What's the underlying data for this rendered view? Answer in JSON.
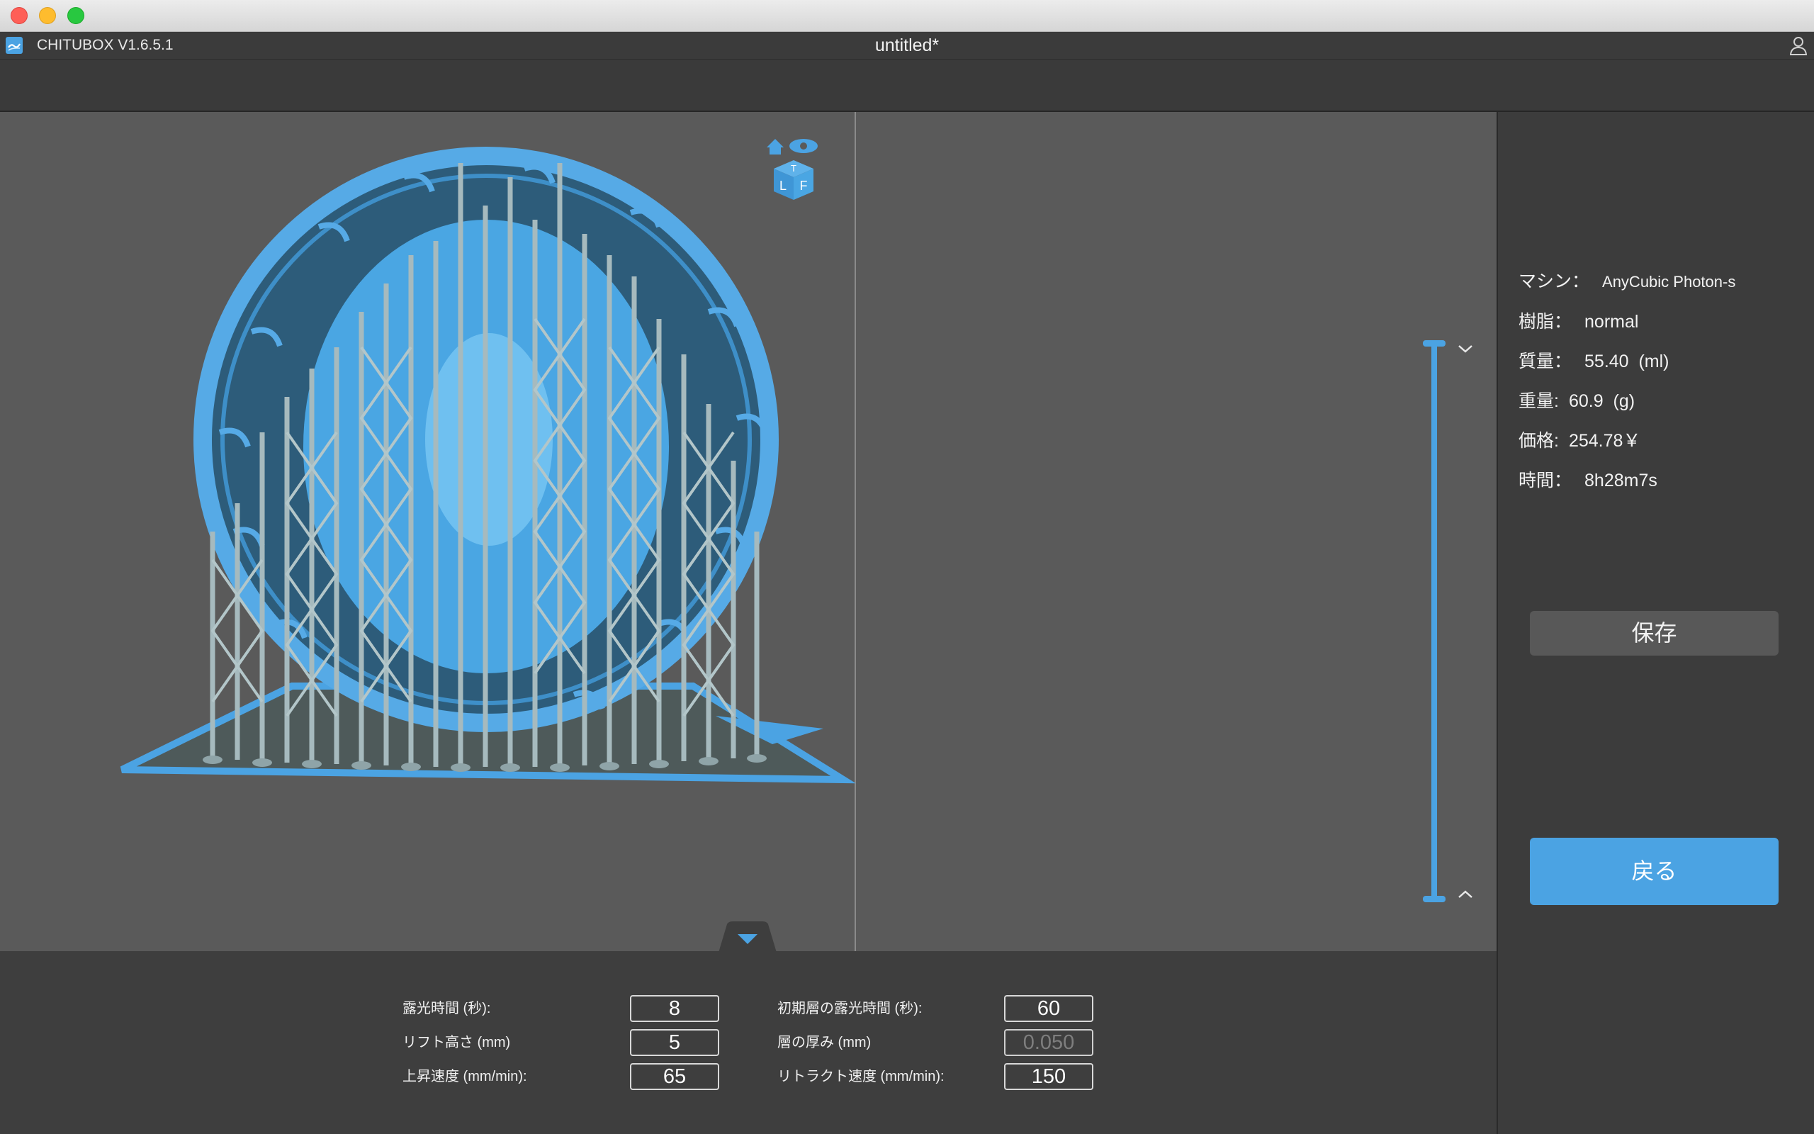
{
  "window": {
    "doc_title": "untitled*"
  },
  "app": {
    "name": "CHITUBOX V1.6.5.1"
  },
  "info": {
    "machine": {
      "label": "マシン：",
      "value": "AnyCubic Photon-s"
    },
    "resin": {
      "label": "樹脂：",
      "value": "normal"
    },
    "volume": {
      "label": "質量：",
      "value": "55.40  (ml)"
    },
    "weight": {
      "label": "重量:",
      "value": "60.9  (g)"
    },
    "price": {
      "label": "価格:",
      "value": "254.78￥"
    },
    "time": {
      "label": "時間：",
      "value": "8h28m7s"
    }
  },
  "buttons": {
    "save": "保存",
    "back": "戻る"
  },
  "params": {
    "exposure_time": {
      "label": "露光時間 (秒):",
      "value": "8"
    },
    "lift_height": {
      "label": "リフト高さ (mm)",
      "value": "5"
    },
    "lift_speed": {
      "label": "上昇速度 (mm/min):",
      "value": "65"
    },
    "bottom_exposure": {
      "label": "初期層の露光時間 (秒):",
      "value": "60"
    },
    "layer_thickness": {
      "label": "層の厚み (mm)",
      "value": "0.050"
    },
    "retract_speed": {
      "label": "リトラクト速度 (mm/min):",
      "value": "150"
    }
  },
  "view_cube": {
    "faces": [
      "T",
      "L",
      "F"
    ]
  },
  "colors": {
    "accent": "#4ba3e3",
    "model": "#9fb3b7",
    "viewport": "#5a5a5a"
  },
  "icons": [
    "home-icon",
    "eye-icon",
    "view-cube-icon",
    "user-icon",
    "chevron-down-icon",
    "chevron-up-icon",
    "collapse-arrow-icon"
  ]
}
